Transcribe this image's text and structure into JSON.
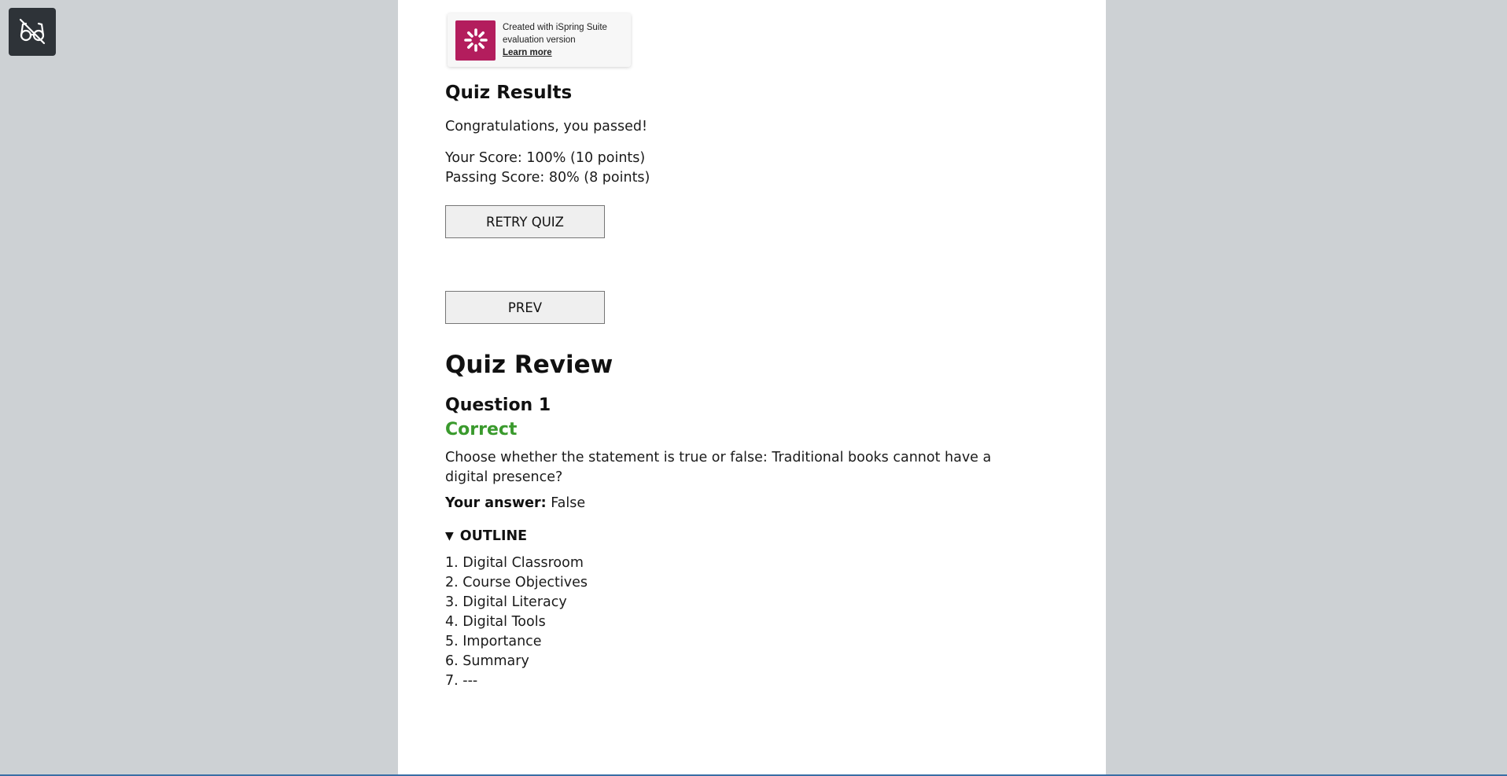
{
  "toggle": {
    "icon": "glasses-off-icon"
  },
  "badge": {
    "line1": "Created with iSpring Suite",
    "line2": "evaluation version",
    "link": "Learn more",
    "logo_color": "#b31d5d"
  },
  "results": {
    "title": "Quiz Results",
    "message": "Congratulations, you passed!",
    "your_score": "Your Score: 100% (10 points)",
    "passing_score": "Passing Score: 80% (8 points)",
    "retry_label": "RETRY QUIZ",
    "prev_label": "PREV"
  },
  "review": {
    "title": "Quiz Review",
    "question_title": "Question 1",
    "status": "Correct",
    "status_color": "#3a9a2d",
    "question_text": "Choose whether the statement is true or false: Traditional books cannot have a digital presence?",
    "answer_label": "Your answer:",
    "answer_value": "False"
  },
  "outline": {
    "title": "OUTLINE",
    "items": [
      "1. Digital Classroom",
      "2. Course Objectives",
      "3. Digital Literacy",
      "4. Digital Tools",
      "5. Importance",
      "6. Summary",
      "7. ---"
    ]
  }
}
